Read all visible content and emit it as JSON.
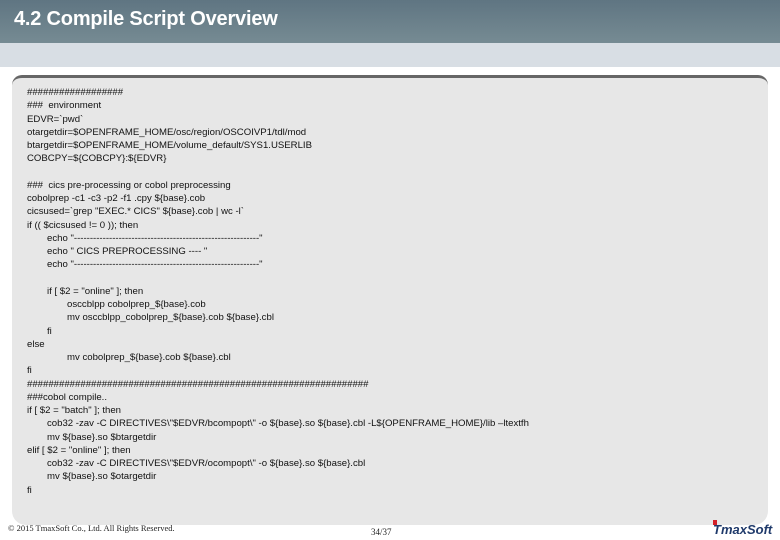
{
  "header": {
    "title": "4.2 Compile Script Overview"
  },
  "code_lines": [
    {
      "indent": 0,
      "text": "##################"
    },
    {
      "indent": 0,
      "text": "###  environment"
    },
    {
      "indent": 0,
      "text": "EDVR=`pwd`"
    },
    {
      "indent": 0,
      "text": "otargetdir=$OPENFRAME_HOME/osc/region/OSCOIVP1/tdl/mod"
    },
    {
      "indent": 0,
      "text": "btargetdir=$OPENFRAME_HOME/volume_default/SYS1.USERLIB"
    },
    {
      "indent": 0,
      "text": "COBCPY=${COBCPY}:${EDVR}"
    },
    {
      "indent": 0,
      "text": ""
    },
    {
      "indent": 0,
      "text": "###  cics pre-processing or cobol preprocessing"
    },
    {
      "indent": 0,
      "text": "cobolprep -c1 -c3 -p2 -f1 .cpy ${base}.cob"
    },
    {
      "indent": 0,
      "text": "cicsused=`grep \"EXEC.* CICS\" ${base}.cob | wc -l`"
    },
    {
      "indent": 0,
      "text": "if (( $cicsused != 0 )); then"
    },
    {
      "indent": 1,
      "text": "echo \"----------------------------------------------------------\""
    },
    {
      "indent": 1,
      "text": "echo \" CICS PREPROCESSING ---- \""
    },
    {
      "indent": 1,
      "text": "echo \"----------------------------------------------------------\""
    },
    {
      "indent": 0,
      "text": ""
    },
    {
      "indent": 1,
      "text": "if [ $2 = \"online\" ]; then"
    },
    {
      "indent": 2,
      "text": "osccblpp cobolprep_${base}.cob"
    },
    {
      "indent": 2,
      "text": "mv osccblpp_cobolprep_${base}.cob ${base}.cbl"
    },
    {
      "indent": 1,
      "text": "fi"
    },
    {
      "indent": 0,
      "text": "else"
    },
    {
      "indent": 2,
      "text": "mv cobolprep_${base}.cob ${base}.cbl"
    },
    {
      "indent": 0,
      "text": "fi"
    },
    {
      "indent": 0,
      "text": "################################################################"
    },
    {
      "indent": 0,
      "text": "###cobol compile.."
    },
    {
      "indent": 0,
      "text": "if [ $2 = \"batch\" ]; then"
    },
    {
      "indent": 1,
      "text": "cob32 -zav -C DIRECTIVES\\\"$EDVR/bcompopt\\\" -o ${base}.so ${base}.cbl -L${OPENFRAME_HOME}/lib –ltextfh"
    },
    {
      "indent": 1,
      "text": "mv ${base}.so $btargetdir"
    },
    {
      "indent": 0,
      "text": "elif [ $2 = \"online\" ]; then"
    },
    {
      "indent": 1,
      "text": "cob32 -zav -C DIRECTIVES\\\"$EDVR/ocompopt\\\" -o ${base}.so ${base}.cbl"
    },
    {
      "indent": 1,
      "text": "mv ${base}.so $otargetdir"
    },
    {
      "indent": 0,
      "text": "fi"
    }
  ],
  "footer": {
    "copyright": "© 2015 TmaxSoft Co., Ltd. All Rights Reserved.",
    "page": "34/37",
    "logo": "TmaxSoft"
  }
}
